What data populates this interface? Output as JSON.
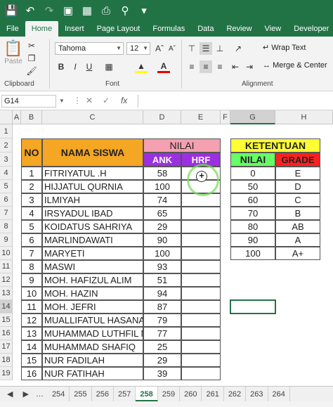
{
  "tabs": [
    "File",
    "Home",
    "Insert",
    "Page Layout",
    "Formulas",
    "Data",
    "Review",
    "View",
    "Developer"
  ],
  "ribbon": {
    "paste_label": "Paste",
    "font_name": "Tahoma",
    "font_size": "12",
    "wrap_text": "Wrap Text",
    "merge_center": "Merge & Center",
    "bold": "B",
    "italic": "I",
    "underline": "U",
    "groups": {
      "clipboard": "Clipboard",
      "font": "Font",
      "alignment": "Alignment"
    }
  },
  "formula_bar": {
    "name_box": "G14",
    "fx": "fx",
    "formula": ""
  },
  "columns": [
    "A",
    "B",
    "C",
    "D",
    "E",
    "F",
    "G",
    "H"
  ],
  "rows": [
    "1",
    "2",
    "3",
    "4",
    "5",
    "6",
    "7",
    "8",
    "9",
    "10",
    "11",
    "12",
    "13",
    "14",
    "15",
    "16",
    "17",
    "18",
    "19"
  ],
  "table": {
    "no_header": "NO",
    "name_header": "NAMA SISWA",
    "nilai_header": "NILAI",
    "ank_header": "ANK",
    "hrf_header": "HRF",
    "students": [
      {
        "no": "1",
        "name": "FITRIYATUL .H",
        "ank": "58"
      },
      {
        "no": "2",
        "name": "HIJJATUL QURNIA",
        "ank": "100"
      },
      {
        "no": "3",
        "name": "ILMIYAH",
        "ank": "74"
      },
      {
        "no": "4",
        "name": "IRSYADUL IBAD",
        "ank": "65"
      },
      {
        "no": "5",
        "name": "KOIDATUS SAHRIYA",
        "ank": "29"
      },
      {
        "no": "6",
        "name": "MARLINDAWATI",
        "ank": "90"
      },
      {
        "no": "7",
        "name": "MARYETI",
        "ank": "100"
      },
      {
        "no": "8",
        "name": "MASWI",
        "ank": "93"
      },
      {
        "no": "9",
        "name": "MOH. HAFIZUL ALIM",
        "ank": "51"
      },
      {
        "no": "10",
        "name": "MOH. HAZIN",
        "ank": "94"
      },
      {
        "no": "11",
        "name": "MOH. JEFRI",
        "ank": "87"
      },
      {
        "no": "12",
        "name": "MUALLIFATUL HASANA",
        "ank": "79"
      },
      {
        "no": "13",
        "name": "MUHAMMAD LUTHFIL M",
        "ank": "77"
      },
      {
        "no": "14",
        "name": "MUHAMMAD SHAFIQ",
        "ank": "25"
      },
      {
        "no": "15",
        "name": "NUR FADILAH",
        "ank": "29"
      },
      {
        "no": "16",
        "name": "NUR FATIHAH",
        "ank": "39"
      }
    ]
  },
  "ketentuan": {
    "title": "KETENTUAN",
    "nilai_header": "NILAI",
    "grade_header": "GRADE",
    "rows": [
      {
        "nilai": "0",
        "grade": "E"
      },
      {
        "nilai": "50",
        "grade": "D"
      },
      {
        "nilai": "60",
        "grade": "C"
      },
      {
        "nilai": "70",
        "grade": "B"
      },
      {
        "nilai": "80",
        "grade": "AB"
      },
      {
        "nilai": "90",
        "grade": "A"
      },
      {
        "nilai": "100",
        "grade": "A+"
      }
    ]
  },
  "sheet_tabs": [
    "254",
    "255",
    "256",
    "257",
    "258",
    "259",
    "260",
    "261",
    "262",
    "263",
    "264"
  ],
  "active_sheet": "258",
  "colors": {
    "excel_green": "#217346",
    "orange": "#f5a623",
    "pink": "#f4a0b0",
    "purple": "#9b30e0",
    "yellow": "#ffff33",
    "light_green": "#66ff66",
    "red": "#ff2020"
  }
}
